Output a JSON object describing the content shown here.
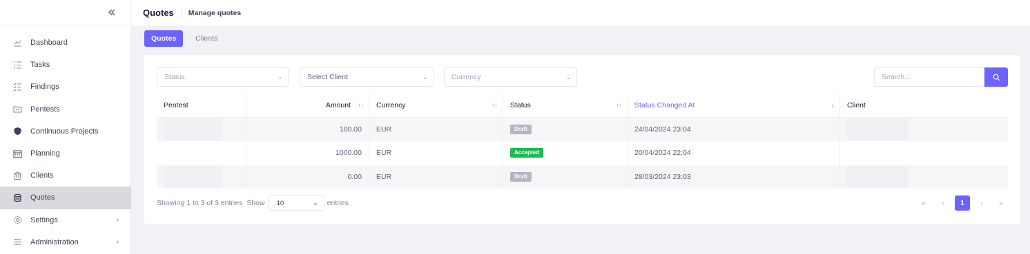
{
  "header": {
    "title": "Quotes",
    "subtitle": "Manage quotes"
  },
  "sidebar": {
    "items": [
      {
        "label": "Dashboard",
        "icon": "chart-line-icon"
      },
      {
        "label": "Tasks",
        "icon": "list-icon"
      },
      {
        "label": "Findings",
        "icon": "checklist-icon"
      },
      {
        "label": "Pentests",
        "icon": "folder-icon"
      },
      {
        "label": "Continuous Projects",
        "icon": "shield-icon"
      },
      {
        "label": "Planning",
        "icon": "calendar-icon"
      },
      {
        "label": "Clients",
        "icon": "bank-icon"
      },
      {
        "label": "Quotes",
        "icon": "coins-icon",
        "active": true
      },
      {
        "label": "Settings",
        "icon": "gear-icon"
      },
      {
        "label": "Administration",
        "icon": "sliders-icon"
      }
    ]
  },
  "tabs": [
    {
      "label": "Quotes",
      "active": true
    },
    {
      "label": "Clients",
      "active": false
    }
  ],
  "filters": {
    "status": "Status",
    "client": "Select Client",
    "currency": "Currency"
  },
  "search": {
    "placeholder": "Search..."
  },
  "table": {
    "headers": [
      "Pentest",
      "Amount",
      "Currency",
      "Status",
      "Status Changed At",
      "Client"
    ],
    "rows": [
      {
        "amount": "100.00",
        "currency": "EUR",
        "status": "Draft",
        "changed_at": "24/04/2024 23:04"
      },
      {
        "amount": "1000.00",
        "currency": "EUR",
        "status": "Accepted",
        "changed_at": "20/04/2024 22:04"
      },
      {
        "amount": "0.00",
        "currency": "EUR",
        "status": "Draft",
        "changed_at": "28/03/2024 23:03"
      }
    ]
  },
  "footer": {
    "info": "Showing 1 to 3 of 3 entries",
    "show_label": "Show",
    "page_length": "10",
    "entries_label": "entries",
    "current_page": "1"
  },
  "colors": {
    "accent": "#6c63ff",
    "draft": "#b5b5c3",
    "accepted": "#1db954"
  }
}
